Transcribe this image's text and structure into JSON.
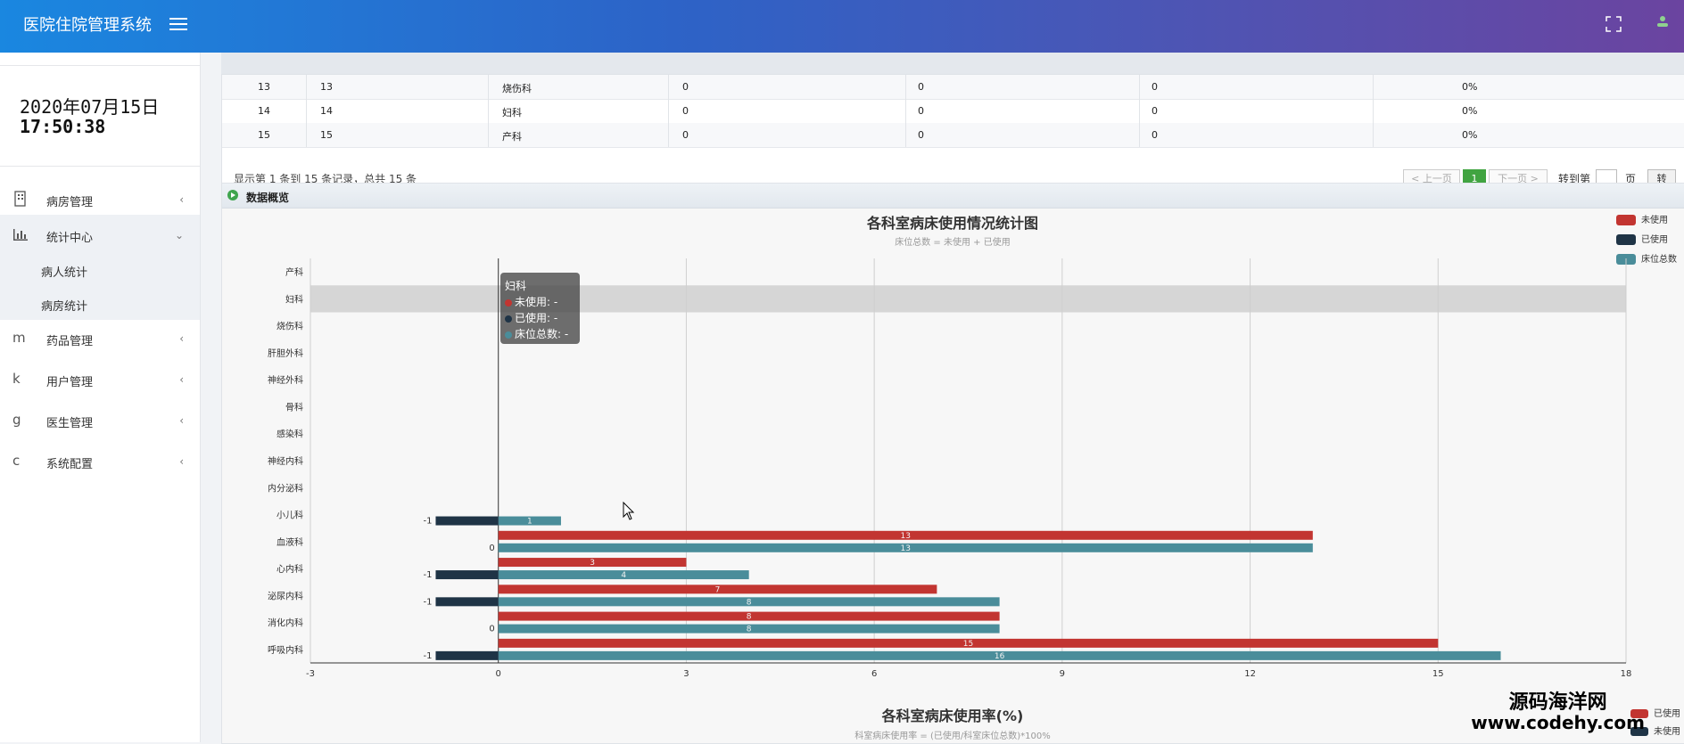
{
  "header": {
    "title": "医院住院管理系统"
  },
  "sidebar": {
    "date": "2020年07月15日",
    "time": "17:50:38",
    "items": [
      {
        "label": "病房管理",
        "icon": "building-icon"
      },
      {
        "label": "统计中心",
        "icon": "bar-chart-icon"
      },
      {
        "label": "药品管理",
        "icon": "m"
      },
      {
        "label": "用户管理",
        "icon": "k"
      },
      {
        "label": "医生管理",
        "icon": "g"
      },
      {
        "label": "系统配置",
        "icon": "c"
      }
    ],
    "subitems": [
      "病人统计",
      "病房统计"
    ]
  },
  "table": {
    "rows": [
      [
        "13",
        "13",
        "烧伤科",
        "0",
        "0",
        "0",
        "0%"
      ],
      [
        "14",
        "14",
        "妇科",
        "0",
        "0",
        "0",
        "0%"
      ],
      [
        "15",
        "15",
        "产科",
        "0",
        "0",
        "0",
        "0%"
      ]
    ]
  },
  "pager": {
    "summary": "显示第 1 条到 15 条记录，总共 15 条",
    "prev": "< 上一页",
    "current": "1",
    "next": "下一页 >",
    "goto": "转到第",
    "page": "页",
    "go": "转"
  },
  "panel": {
    "title": "数据概览"
  },
  "chart_data": [
    {
      "type": "bar",
      "title": "各科室病床使用情况统计图",
      "subtitle": "床位总数 = 未使用 + 已使用",
      "orientation": "horizontal",
      "categories": [
        "呼吸内科",
        "消化内科",
        "泌尿内科",
        "心内科",
        "血液科",
        "小儿科",
        "内分泌科",
        "神经内科",
        "感染科",
        "骨科",
        "神经外科",
        "肝胆外科",
        "烧伤科",
        "妇科",
        "产科"
      ],
      "series": [
        {
          "name": "未使用",
          "color": "#c23531",
          "values": [
            15,
            8,
            7,
            3,
            13,
            null,
            null,
            null,
            null,
            null,
            null,
            null,
            null,
            null,
            null
          ]
        },
        {
          "name": "已使用",
          "color": "#1f3446",
          "values": [
            -1,
            0,
            -1,
            -1,
            0,
            -1,
            null,
            null,
            null,
            null,
            null,
            null,
            null,
            null,
            null
          ]
        },
        {
          "name": "床位总数",
          "color": "#4a8d9a",
          "values": [
            16,
            8,
            8,
            4,
            13,
            1,
            null,
            null,
            null,
            null,
            null,
            null,
            null,
            null,
            null
          ]
        }
      ],
      "xlim": [
        -3,
        18
      ],
      "xticks": [
        "-3",
        "0",
        "3",
        "6",
        "9",
        "12",
        "15",
        "18"
      ],
      "legend": "top-right",
      "grid": true,
      "tooltip": {
        "title": "妇科",
        "lines": [
          "未使用: -",
          "已使用: -",
          "床位总数: -"
        ]
      }
    },
    {
      "type": "bar",
      "title": "各科室病床使用率(%)",
      "subtitle": "科室病床使用率 = (已使用/科室床位总数)*100%",
      "series": [
        {
          "name": "已使用",
          "color": "#c23531"
        },
        {
          "name": "未使用",
          "color": "#1f3446"
        }
      ]
    }
  ],
  "watermark": {
    "line1": "源码海洋网",
    "line2": "www.codehy.com"
  }
}
